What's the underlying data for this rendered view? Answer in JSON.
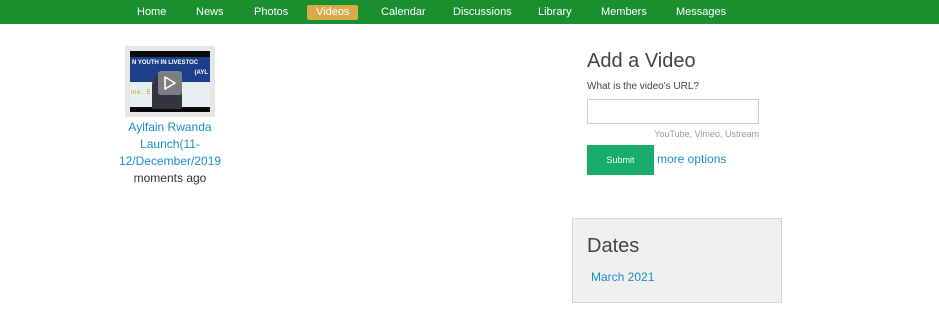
{
  "nav": {
    "items": [
      {
        "label": "Home",
        "active": false
      },
      {
        "label": "News",
        "active": false
      },
      {
        "label": "Photos",
        "active": false
      },
      {
        "label": "Videos",
        "active": true
      },
      {
        "label": "Calendar",
        "active": false
      },
      {
        "label": "Discussions",
        "active": false
      },
      {
        "label": "Library",
        "active": false
      },
      {
        "label": "Members",
        "active": false
      },
      {
        "label": "Messages",
        "active": false
      }
    ]
  },
  "video": {
    "thumbnail_text_1": "N YOUTH IN LIVESTOC",
    "thumbnail_text_2": "(AYL",
    "thumbnail_text_3": "me: E    outh in",
    "title": "Aylfain Rwanda Launch(11-12/December/2019",
    "time": "moments ago"
  },
  "add_video": {
    "heading": "Add a Video",
    "url_label": "What is the video's URL?",
    "url_value": "",
    "hint": "YouTube, Vimeo, Ustream",
    "submit_label": "Submit",
    "more_options_label": "more options"
  },
  "dates": {
    "heading": "Dates",
    "items": [
      "March 2021"
    ]
  },
  "colors": {
    "nav_bg": "#1a8f2f",
    "nav_active": "#d9a94a",
    "link": "#1a8fc5",
    "submit_bg": "#15ad69"
  }
}
